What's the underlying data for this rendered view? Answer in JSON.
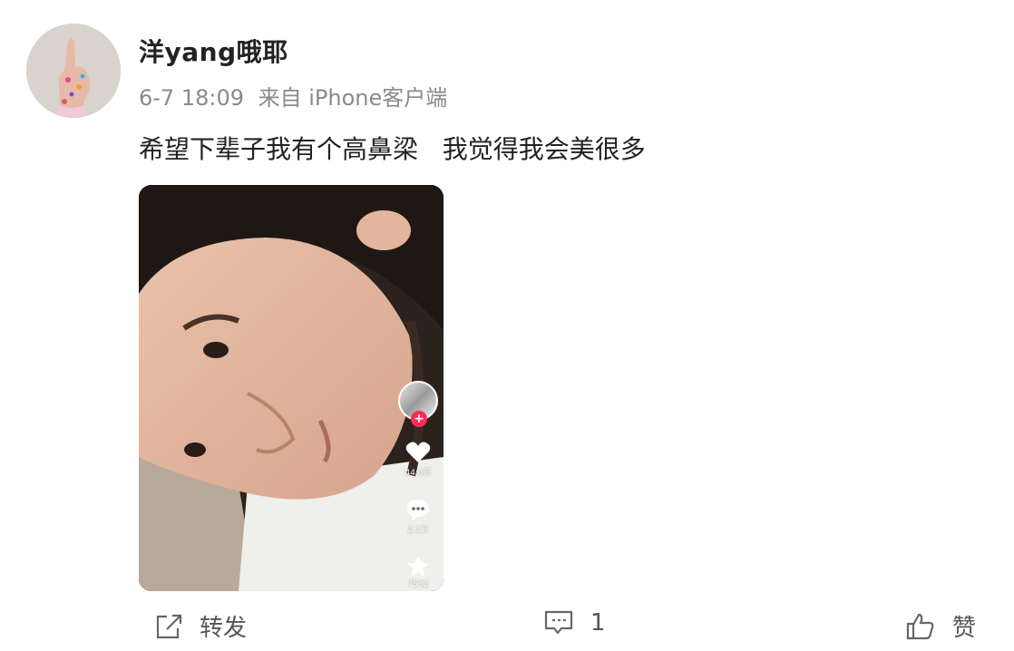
{
  "post": {
    "username": "洋yang哦耶",
    "time": "6-7 18:09",
    "source": "来自 iPhone客户端",
    "text": "希望下辈子我有个高鼻梁   我觉得我会美很多"
  },
  "media": {
    "likes": "44.0万",
    "comments": "2.1万",
    "favorites": "7532",
    "follow_symbol": "+"
  },
  "actions": {
    "repost_label": "转发",
    "comment_count": "1",
    "like_label": "赞"
  }
}
